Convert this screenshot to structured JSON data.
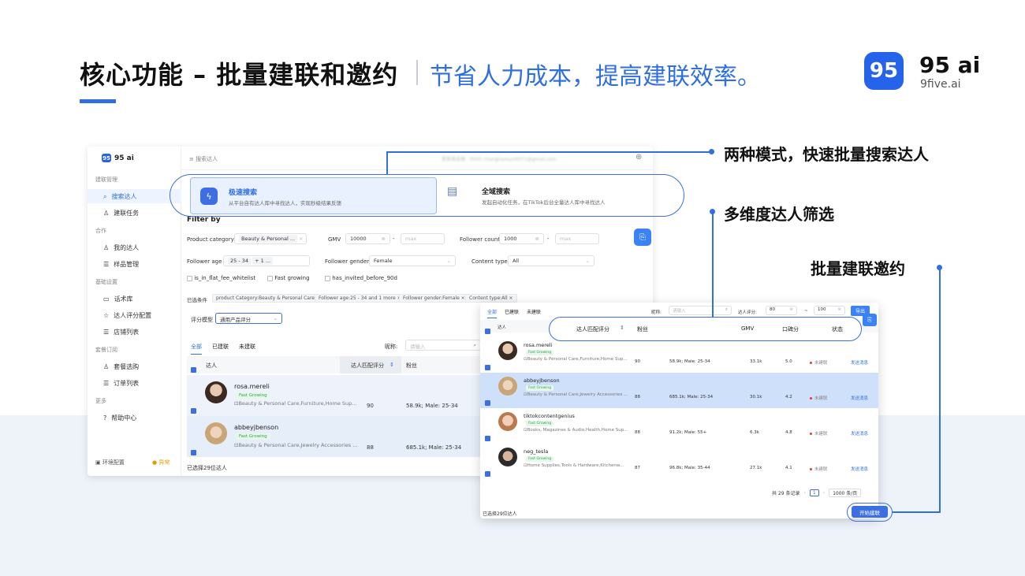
{
  "slide": {
    "title": "核心功能 – 批量建联和邀约",
    "subtitle": "节省人力成本，提高建联效率。",
    "brand_badge": "95",
    "brand_name": "95 ai",
    "brand_site": "9five.ai",
    "accent_color": "#2f6fe0"
  },
  "annotations": {
    "a1": "两种模式，快速批量搜索达人",
    "a2": "多维度达人筛选",
    "a3": "批量建联邀约"
  },
  "app": {
    "brand": "95 ai",
    "sidebar": {
      "sections": [
        {
          "title": "建联管理",
          "items": [
            "搜索达人",
            "建联任务"
          ]
        },
        {
          "title": "合作",
          "items": [
            "我的达人",
            "样品管理"
          ]
        },
        {
          "title": "基础设置",
          "items": [
            "话术库",
            "达人评分配置",
            "店铺列表"
          ]
        },
        {
          "title": "套餐订阅",
          "items": [
            "套餐选购",
            "订单列表"
          ]
        },
        {
          "title": "更多",
          "items": [
            "帮助中心"
          ]
        }
      ],
      "footer": "环境配置",
      "footer_status": "异常"
    },
    "topbar": {
      "breadcrumb": "搜索达人",
      "user_blurred": "某某某店铺 · 0000  changhaosun6071@gmail.com"
    },
    "modes": [
      {
        "title": "极速搜索",
        "desc": "从平台自有达人库中寻找达人，实现秒级结果反馈"
      },
      {
        "title": "全域搜索",
        "desc": "发起自动化任务，在TikTok后台全量达人库中寻找达人"
      }
    ],
    "filters": {
      "heading": "Filter by",
      "product_category_label": "Product category",
      "product_category_value": "Beauty & Personal ...",
      "gmv_label": "GMV",
      "gmv_min": "10000",
      "gmv_max_placeholder": "max",
      "follower_count_label": "Follower count",
      "follower_min": "1000",
      "follower_max_placeholder": "max",
      "follower_age_label": "Follower age",
      "follower_age_value": "25 - 34",
      "follower_age_more": "+ 1 ...",
      "follower_gender_label": "Follower gender",
      "follower_gender_value": "Female",
      "content_type_label": "Content type",
      "content_type_value": "All",
      "check1": "is_in_flat_fee_whitelist",
      "check2": "Fast growing",
      "check3": "has_invited_before_90d",
      "selected_label": "已选条件",
      "chips": [
        "product Category:Beauty & Personal Care",
        "Follower age:25 - 34 and 1 more",
        "Follower gender:Female",
        "Content type:All"
      ],
      "score_model_label": "评分模型",
      "score_model_value": "通用产品评分"
    },
    "list": {
      "tabs": [
        "全部",
        "已建联",
        "未建联"
      ],
      "nickname_label": "昵称:",
      "nickname_placeholder": "请输入",
      "col_creator": "达人",
      "col_score": "达人匹配评分",
      "col_fans": "粉丝",
      "rows": [
        {
          "name": "rosa.mereli",
          "tag": "Fast Growing",
          "cat": "Beauty & Personal Care,Furniture,Home Sup...",
          "score": "90",
          "fans": "58.9k; Male: 25-34"
        },
        {
          "name": "abbeyjbenson",
          "tag": "Fast Growing",
          "cat": "Beauty & Personal Care,Jewelry Accessories ...",
          "score": "88",
          "fans": "685.1k; Male: 25-34"
        }
      ],
      "footer": "已选择29位达人"
    }
  },
  "panel": {
    "tabs": [
      "全部",
      "已建联",
      "未建联"
    ],
    "nickname_label": "昵称:",
    "nickname_placeholder": "请输入",
    "score_label": "达人评分:",
    "score_min": "80",
    "score_max": "100",
    "export": "导出",
    "cols": {
      "creator": "达人",
      "score": "达人匹配评分",
      "fans": "粉丝",
      "gmv": "GMV",
      "rep": "口碑分",
      "status": "状态"
    },
    "rows": [
      {
        "name": "rosa.mereli",
        "tag": "Fast Growing",
        "cat": "Beauty & Personal Care,Furniture,Home Sup...",
        "score": "90",
        "fans": "58.9k; Male: 25-34",
        "gmv": "33.1k",
        "rep": "5.0",
        "status": "未建联",
        "action": "发送消息"
      },
      {
        "name": "abbeyjbenson",
        "tag": "Fast Growing",
        "cat": "Beauty & Personal Care,Jewelry Accessories ...",
        "score": "88",
        "fans": "685.1k; Male: 25-34",
        "gmv": "30.1k",
        "rep": "4.2",
        "status": "未建联",
        "action": "发送消息"
      },
      {
        "name": "tiktokcontentgenius",
        "tag": "Fast Growing",
        "cat": "Books, Magazines & Audio,Health,Home Sup...",
        "score": "88",
        "fans": "91.2k; Male: 55+",
        "gmv": "6.3k",
        "rep": "4.8",
        "status": "未建联",
        "action": "发送消息"
      },
      {
        "name": "neg_tesla",
        "tag": "Fast Growing",
        "cat": "Home Supplies,Tools & Hardware,Kitchenw...",
        "score": "87",
        "fans": "96.8k; Male: 35-44",
        "gmv": "27.1k",
        "rep": "4.1",
        "status": "未建联",
        "action": "发送消息"
      }
    ],
    "total": "共 29 条记录",
    "page": "1",
    "page_size": "1000 条/页",
    "footer": "已选择29位达人",
    "start_button": "开始建联"
  }
}
